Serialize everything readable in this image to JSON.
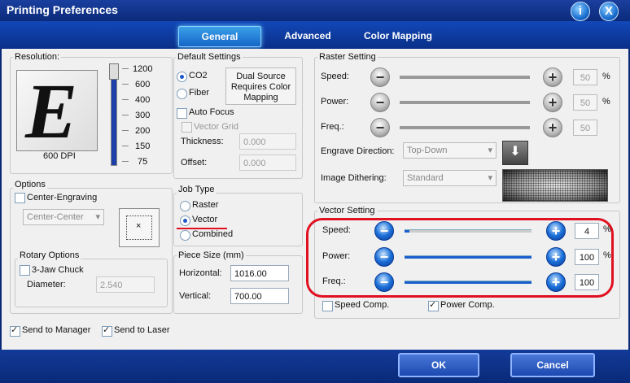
{
  "window": {
    "title": "Printing Preferences",
    "info_icon": "i",
    "close_icon": "X"
  },
  "tabs": [
    {
      "label": "General",
      "active": true
    },
    {
      "label": "Advanced"
    },
    {
      "label": "Color Mapping"
    }
  ],
  "resolution": {
    "label": "Resolution:",
    "preview_letter": "E",
    "dpi_text": "600 DPI",
    "ticks": [
      "1200",
      "600",
      "400",
      "300",
      "200",
      "150",
      "75"
    ]
  },
  "default_settings": {
    "label": "Default Settings",
    "co2": "CO2",
    "fiber": "Fiber",
    "dual_source_note": "Dual Source Requires Color Mapping",
    "auto_focus": "Auto Focus",
    "vector_grid": "Vector Grid",
    "thickness_label": "Thickness:",
    "thickness_value": "0.000",
    "offset_label": "Offset:",
    "offset_value": "0.000"
  },
  "raster": {
    "label": "Raster Setting",
    "speed_label": "Speed:",
    "speed_value": "50",
    "speed_unit": "%",
    "power_label": "Power:",
    "power_value": "50",
    "power_unit": "%",
    "freq_label": "Freq.:",
    "freq_value": "50",
    "engrave_label": "Engrave Direction:",
    "engrave_value": "Top-Down",
    "dither_label": "Image Dithering:",
    "dither_value": "Standard"
  },
  "options": {
    "label": "Options",
    "center_engraving": "Center-Engraving",
    "center_select": "Center-Center",
    "rotary_label": "Rotary Options",
    "jaw_chuck": "3-Jaw Chuck",
    "diameter_label": "Diameter:",
    "diameter_value": "2.540"
  },
  "job_type": {
    "label": "Job Type",
    "raster": "Raster",
    "vector": "Vector",
    "combined": "Combined"
  },
  "piece_size": {
    "label": "Piece Size (mm)",
    "horizontal_label": "Horizontal:",
    "horizontal_value": "1016.00",
    "vertical_label": "Vertical:",
    "vertical_value": "700.00"
  },
  "vector": {
    "label": "Vector Setting",
    "speed_label": "Speed:",
    "speed_value": "4",
    "speed_unit": "%",
    "speed_level": 0.04,
    "power_label": "Power:",
    "power_value": "100",
    "power_unit": "%",
    "power_level": 1.0,
    "freq_label": "Freq.:",
    "freq_value": "100",
    "freq_level": 1.0,
    "speed_comp": "Speed Comp.",
    "power_comp": "Power Comp."
  },
  "bottom": {
    "send_manager": "Send to Manager",
    "send_laser": "Send to Laser"
  },
  "buttons": {
    "ok": "OK",
    "cancel": "Cancel"
  },
  "colors": {
    "annotation": "#e01020",
    "accent": "#1b5fcc"
  }
}
